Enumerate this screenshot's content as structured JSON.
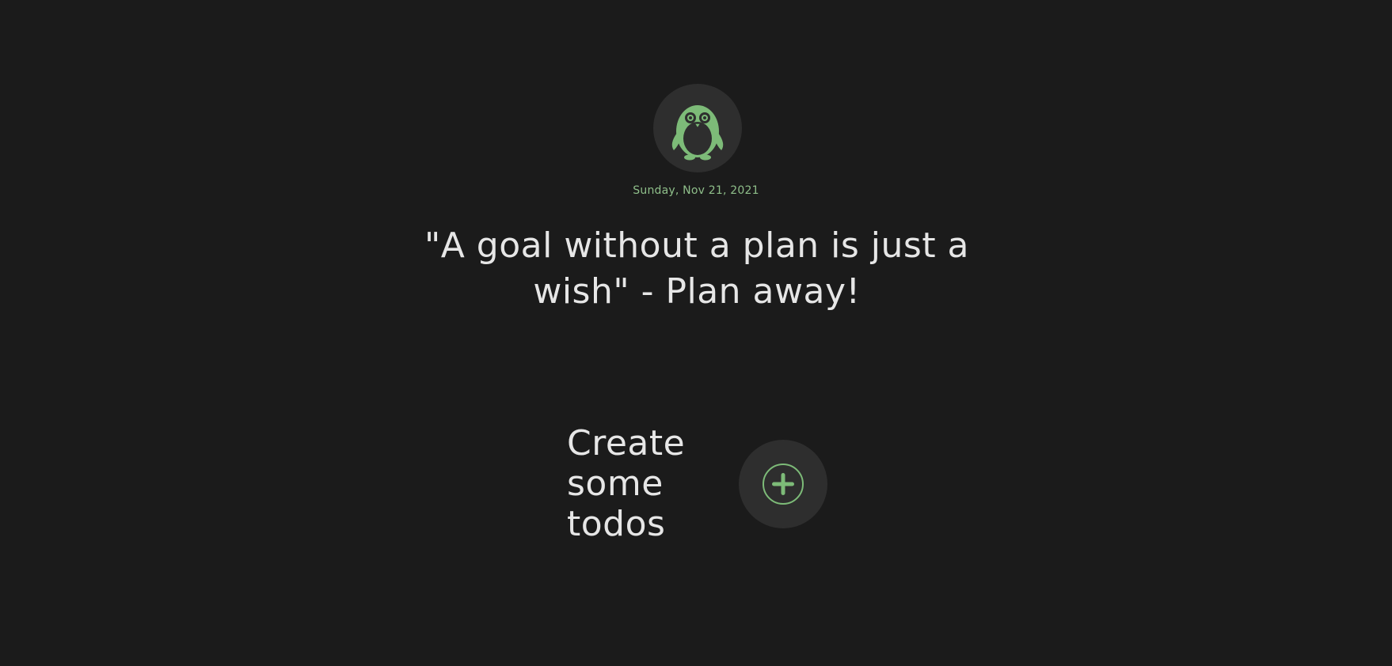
{
  "header": {
    "avatar_icon": "penguin-icon",
    "date": "Sunday, Nov 21, 2021",
    "quote": "\"A goal without a plan is just a wish\" - Plan away!"
  },
  "empty_state": {
    "message": "Create some todos",
    "add_icon": "plus-circle-icon"
  },
  "colors": {
    "background": "#1b1b1b",
    "surface": "#2e2e2e",
    "accent": "#7dbb78",
    "text": "#e6e6e6"
  }
}
